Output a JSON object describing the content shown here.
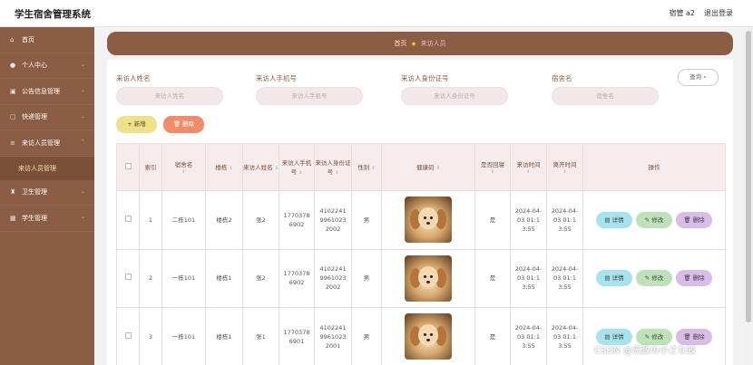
{
  "header": {
    "title": "学生宿舍管理系统",
    "user": "宿管 a2",
    "logout": "退出登录"
  },
  "sidebar": {
    "items": [
      {
        "label": "首页",
        "icon": "home-icon"
      },
      {
        "label": "个人中心",
        "icon": "user-icon"
      },
      {
        "label": "公告信息管理",
        "icon": "notice-icon"
      },
      {
        "label": "快递管理",
        "icon": "package-icon"
      },
      {
        "label": "来访人员管理",
        "icon": "list-icon"
      },
      {
        "label": "卫生管理",
        "icon": "broom-icon"
      },
      {
        "label": "学生管理",
        "icon": "grid-icon"
      }
    ],
    "active_sub": "来访人员管理"
  },
  "breadcrumb": {
    "home": "首页",
    "current": "来访人员"
  },
  "filters": [
    {
      "label": "来访人姓名",
      "placeholder": "来访人姓名"
    },
    {
      "label": "来访人手机号",
      "placeholder": "来访人手机号"
    },
    {
      "label": "来访人身份证号",
      "placeholder": "来访人身份证号"
    },
    {
      "label": "宿舍名",
      "placeholder": "宿舍名"
    }
  ],
  "buttons": {
    "search": "查询",
    "add": "新增",
    "delete": "删除",
    "detail": "详情",
    "edit": "修改",
    "row_delete": "删除"
  },
  "table": {
    "columns": [
      "索引",
      "宿舍名",
      "楼栋",
      "来访人姓名",
      "来访人手机号",
      "来访人身份证号",
      "性别",
      "健康码",
      "是否回寝",
      "来访时间",
      "离开时间",
      "操作"
    ],
    "rows": [
      {
        "index": "1",
        "dorm": "二栋101",
        "building": "楼栋2",
        "name": "张2",
        "phone": "17703786902",
        "idcard": "410224199610232002",
        "gender": "男",
        "returned": "是",
        "visit_time": "2024-04-03 01:13:55",
        "leave_time": "2024-04-03 01:13:55"
      },
      {
        "index": "2",
        "dorm": "一栋101",
        "building": "楼栋1",
        "name": "张2",
        "phone": "17703786902",
        "idcard": "410224199610232002",
        "gender": "男",
        "returned": "是",
        "visit_time": "2024-04-03 01:13:55",
        "leave_time": "2024-04-03 01:13:55"
      },
      {
        "index": "3",
        "dorm": "一栋101",
        "building": "楼栋1",
        "name": "张1",
        "phone": "17703786901",
        "idcard": "410224199610232001",
        "gender": "男",
        "returned": "是",
        "visit_time": "2024-04-03 01:13:55",
        "leave_time": "2024-04-03 01:13:55"
      }
    ]
  },
  "watermark": "CSDN @无敌の小さな蛟"
}
